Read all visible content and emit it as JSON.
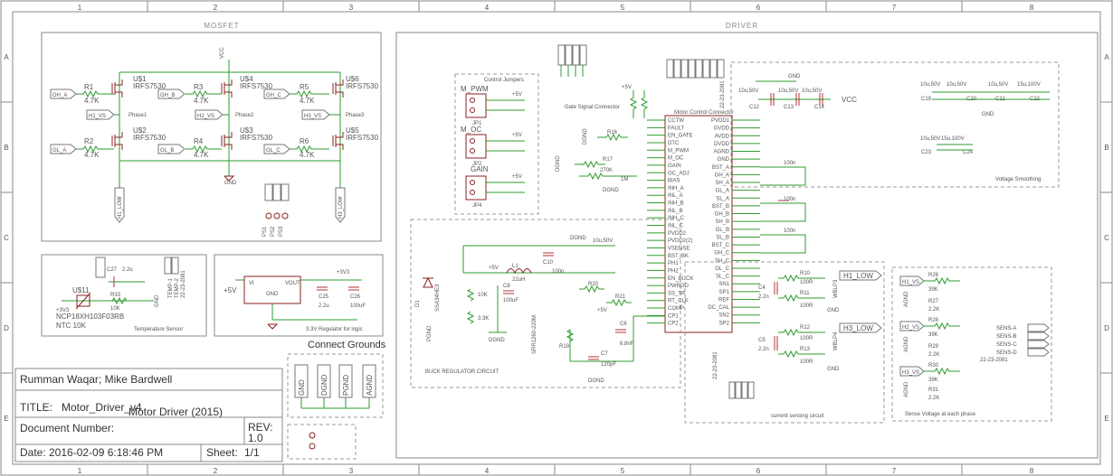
{
  "columns": [
    "1",
    "2",
    "3",
    "4",
    "5",
    "6",
    "7",
    "8"
  ],
  "rows": [
    "A",
    "B",
    "C",
    "D",
    "E"
  ],
  "sections": {
    "mosfet": "MOSFET",
    "driver": "DRIVER",
    "temperature_sensor": "Temperature Sensor",
    "regulator": "3.3V Regulator for logic",
    "connect_grounds": "Connect Grounds",
    "buck": "BUCK REGULATOR CIRCUIT",
    "current_sense": "current sensing circuit",
    "sense_voltage": "Sense Voltage at each phase",
    "voltage_smoothing": "Voltage Smoothing",
    "control_jumpers": "Control Jumpers",
    "motor_control_connector": "Motor Control Connector",
    "gate_signal": "Gate Signal Connector"
  },
  "mosfet": {
    "transistors": [
      {
        "ref": "U$1",
        "part": "IRFS7530"
      },
      {
        "ref": "U$2",
        "part": "IRFS7530"
      },
      {
        "ref": "U$4",
        "part": "IRFS7530"
      },
      {
        "ref": "U$3",
        "part": "IRFS7530"
      },
      {
        "ref": "U$6",
        "part": "IRFS7530"
      },
      {
        "ref": "U$5",
        "part": "IRFS7530"
      }
    ],
    "resistors": [
      {
        "ref": "R1",
        "value": "4.7K"
      },
      {
        "ref": "R2",
        "value": "4.7K"
      },
      {
        "ref": "R3",
        "value": "4.7K"
      },
      {
        "ref": "R4",
        "value": "4.7K"
      },
      {
        "ref": "R5",
        "value": "4.7K"
      },
      {
        "ref": "R6",
        "value": "4.7K"
      }
    ],
    "nets": [
      "GH_A",
      "GL_A",
      "GH_B",
      "GL_B",
      "GH_C",
      "GL_C",
      "H1_VS",
      "H2_VS",
      "H3_VS",
      "H1_LOW",
      "H3_LOW",
      "VCC",
      "GND"
    ],
    "phases": [
      "Phase1",
      "Phase2",
      "Phase3"
    ],
    "pads": [
      "PS1",
      "PS2",
      "PS3"
    ]
  },
  "temperature": {
    "ref": "U$11",
    "part": "NCP18XH103F03RB",
    "ntc": "NTC 10K",
    "c27": "C27",
    "c27_value": "2.2u",
    "r33": "R33",
    "r33_value": "10K",
    "vdd": "+3V3",
    "gnd": "GND",
    "temp_nets": [
      "TEMP-1",
      "TEMP-2"
    ],
    "date": "22-23-2081"
  },
  "regulator": {
    "ref": "U$11",
    "vi": "VI",
    "vout": "VOUT",
    "gnd": "GND",
    "vin": "+5V",
    "vout_net": "+3V3",
    "c25": "C25",
    "c25_value": "2.2u",
    "c26": "C26",
    "c26_value": "100uF"
  },
  "grounds": [
    "GND",
    "DGND",
    "PGND",
    "AGND"
  ],
  "title_block": {
    "authors": "Rumman Waqar; Mike Bardwell",
    "title_label": "TITLE:",
    "title_file": "Motor_Driver_v4",
    "title_desc": "Motor Driver (2015)",
    "docnum_label": "Document Number:",
    "rev_label": "REV:",
    "rev": "1.0",
    "date_label": "Date:",
    "date": "2016-02-09 6:18:46 PM",
    "sheet_label": "Sheet:",
    "sheet": "1/1"
  },
  "driver": {
    "left_pins": [
      "CCTW",
      "FAULT",
      "EN_GATE",
      "DTC",
      "M_PWM",
      "M_OC",
      "GAIN",
      "OC_ADJ",
      "BIAS",
      "INH_A",
      "INL_A",
      "INH_B",
      "INL_B",
      "INH_C",
      "INL_C",
      "PVDD2",
      "PVDD2(2)",
      "VSENSE",
      "BST_BK",
      "PH1",
      "PH2",
      "EN_BUCK",
      "PWRGD",
      "SS_TR",
      "RT_CLK",
      "COMP",
      "CP1",
      "CP2"
    ],
    "right_pins": [
      "PVDD1",
      "GVDD",
      "AVDD",
      "DVDD",
      "AGND",
      "GND",
      "BST_A",
      "GH_A",
      "SH_A",
      "GL_A",
      "SL_A",
      "BST_B",
      "GH_B",
      "SH_B",
      "GL_B",
      "SL_B",
      "BST_C",
      "GH_C",
      "SH_C",
      "GL_C",
      "SL_C",
      "SN1",
      "SP1",
      "REF",
      "DC_CAL",
      "SN2",
      "SP2"
    ],
    "components": {
      "r16": "R16",
      "r17": "R17",
      "r18": "R18",
      "r_1m": "1M",
      "r_270k": "270K",
      "r_10k": "10K",
      "c13": "C13",
      "c14": "C14",
      "c12": "C12",
      "c_10u50v": "10u,50V",
      "c_22n": "22n",
      "c_22u": "2.2u",
      "c_100n": "100n",
      "c_1n": "1nF",
      "l1": "L1",
      "l1_value": "22uH",
      "c8": "C8",
      "c8_value": "100uF",
      "c10": "C10",
      "c11": "C11",
      "r26": "R26",
      "r27": "R27",
      "r28": "R28",
      "r29": "R29",
      "r30": "R30",
      "r31": "R31",
      "r_39k": "39K",
      "r_22k": "2.2K",
      "c4": "C4",
      "c5": "C5",
      "c_22nf": "2.2n",
      "r10": "R10",
      "r11": "R11",
      "r12": "R12",
      "r13": "R13",
      "r_100r": "100R",
      "c19": "C19",
      "c20": "C20",
      "c21": "C21",
      "c22": "C22",
      "c23": "C23",
      "c24": "C24",
      "c_15u100v": "15u,100V"
    },
    "jumpers": [
      "JP1",
      "JP2",
      "JP4"
    ],
    "jumper_nets": [
      "M_PWM",
      "M_OC",
      "GAIN"
    ],
    "supply": [
      "+5V",
      "VCC",
      "GND",
      "DGND",
      "AGND",
      "PGND",
      "+3V3"
    ],
    "sense_nets": [
      "SENS-A",
      "SENS-B",
      "SENS-C",
      "SENS-D"
    ],
    "sense_labels": [
      "H1_VS",
      "H2_VS",
      "H3_VS"
    ],
    "low_nets": [
      "H1_LOW",
      "H3_LOW"
    ],
    "date": "22-23-2081",
    "coil": "SRR1260-220M",
    "diode": "D1",
    "diode_part": "SSA34HE3",
    "buck_parts": [
      "R19",
      "R20",
      "R21",
      "R22",
      "R23",
      "R24",
      "R25",
      "C6",
      "C7",
      "C9"
    ],
    "buck_values": [
      "10K",
      "3.3K",
      "1nF",
      "6.8nF",
      "120pF",
      "100nF",
      "22nF"
    ],
    "wiper_labels": [
      "WBLP3",
      "WBLP4"
    ]
  }
}
